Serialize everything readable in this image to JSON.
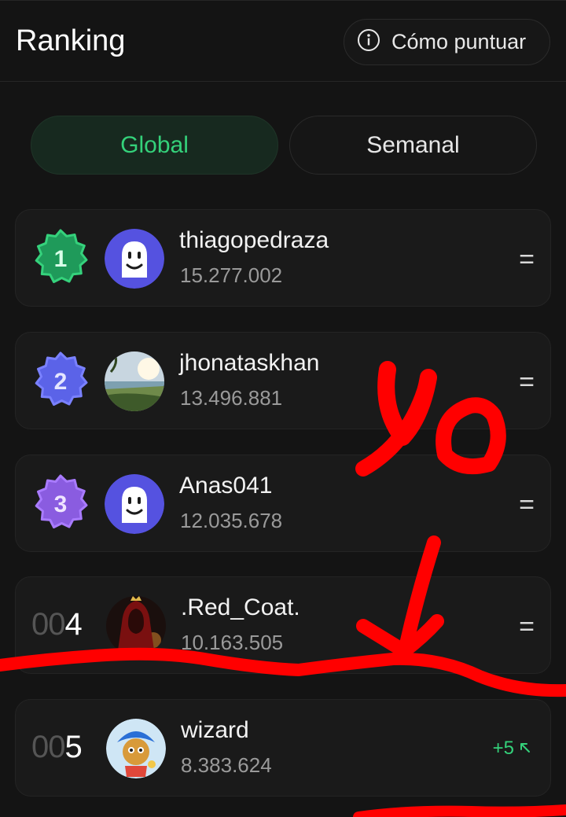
{
  "header": {
    "title": "Ranking",
    "howto_label": "Cómo puntuar"
  },
  "tabs": [
    {
      "label": "Global",
      "active": true
    },
    {
      "label": "Semanal",
      "active": false
    }
  ],
  "colors": {
    "accent": "#34d17a",
    "rank1": "#1f9a5a",
    "rank2": "#5b63e8",
    "rank3": "#8a5ce0",
    "annotation": "#ff0000"
  },
  "ranking": [
    {
      "rank": "1",
      "name": "thiagopedraza",
      "score": "15.277.002",
      "trend": "=",
      "avatar": "ghost-avatar"
    },
    {
      "rank": "2",
      "name": "jhonataskhan",
      "score": "13.496.881",
      "trend": "=",
      "avatar": "beach-photo-avatar"
    },
    {
      "rank": "3",
      "name": "Anas041",
      "score": "12.035.678",
      "trend": "=",
      "avatar": "ghost-avatar"
    },
    {
      "rank_prefix": "00",
      "rank": "4",
      "name": ".Red_Coat.",
      "score": "10.163.505",
      "trend": "=",
      "avatar": "red-hood-avatar"
    },
    {
      "rank_prefix": "00",
      "rank": "5",
      "name": "wizard",
      "score": "8.383.624",
      "trend": "+5",
      "trend_icon": "arrow-up-left-icon",
      "avatar": "cartoon-monkey-avatar"
    }
  ],
  "annotation": {
    "text": "yo"
  }
}
